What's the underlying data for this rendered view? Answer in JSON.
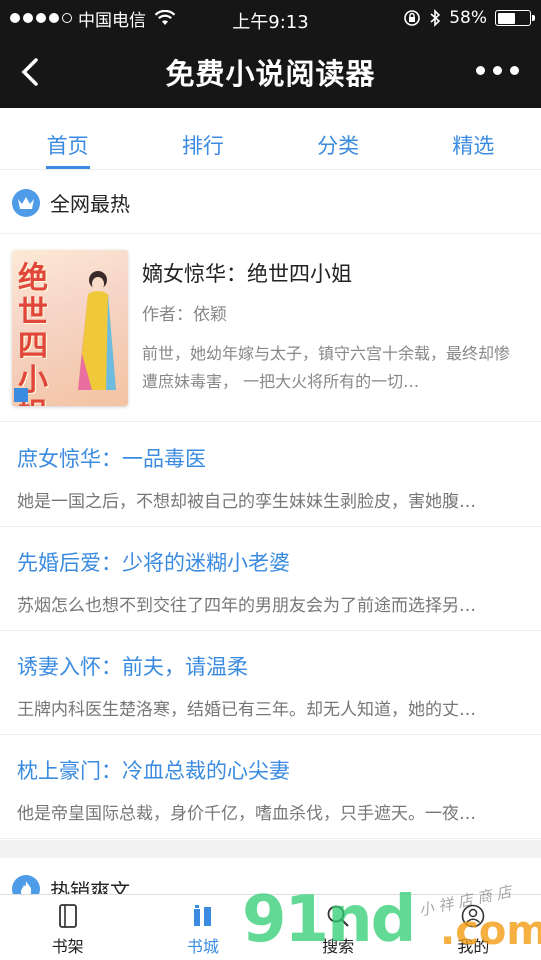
{
  "status_bar": {
    "carrier": "中国电信",
    "time": "上午9:13",
    "battery": "58%",
    "battery_level": 0.58
  },
  "nav": {
    "title": "免费小说阅读器"
  },
  "tabs": [
    {
      "label": "首页",
      "active": true
    },
    {
      "label": "排行",
      "active": false
    },
    {
      "label": "分类",
      "active": false
    },
    {
      "label": "精选",
      "active": false
    }
  ],
  "section_hot": {
    "title": "全网最热",
    "icon": "crown-icon"
  },
  "featured": {
    "title": "嫡女惊华：绝世四小姐",
    "author": "作者：依颖",
    "description": "前世，她幼年嫁与太子，镇守六宫十余载，最终却惨遭庶妹毒害， 一把大火将所有的一切…",
    "cover_text": "绝世四小姐"
  },
  "items": [
    {
      "title": "庶女惊华：一品毒医",
      "desc": "她是一国之后，不想却被自己的孪生妹妹生剥脸皮，害她腹…"
    },
    {
      "title": "先婚后爱：少将的迷糊小老婆",
      "desc": "苏烟怎么也想不到交往了四年的男朋友会为了前途而选择另…"
    },
    {
      "title": "诱妻入怀：前夫，请温柔",
      "desc": "王牌内科医生楚洛寒，结婚已有三年。却无人知道，她的丈…"
    },
    {
      "title": "枕上豪门：冷血总裁的心尖妻",
      "desc": "他是帝皇国际总裁，身价千亿，嗜血杀伐，只手遮天。一夜…"
    }
  ],
  "section_bestseller": {
    "title": "热销爽文",
    "icon": "fire-icon"
  },
  "bottom_tabs": [
    {
      "label": "书架",
      "icon": "bookshelf-icon",
      "active": false
    },
    {
      "label": "书城",
      "icon": "bookstore-icon",
      "active": true
    },
    {
      "label": "搜索",
      "icon": "search-icon",
      "active": false
    },
    {
      "label": "我的",
      "icon": "user-icon",
      "active": false
    }
  ],
  "watermark": {
    "main": "91nd",
    "suffix": ".com",
    "tagline": "小 祥 店 商 店"
  },
  "colors": {
    "accent": "#3b8be0",
    "topbar": "#161616"
  }
}
